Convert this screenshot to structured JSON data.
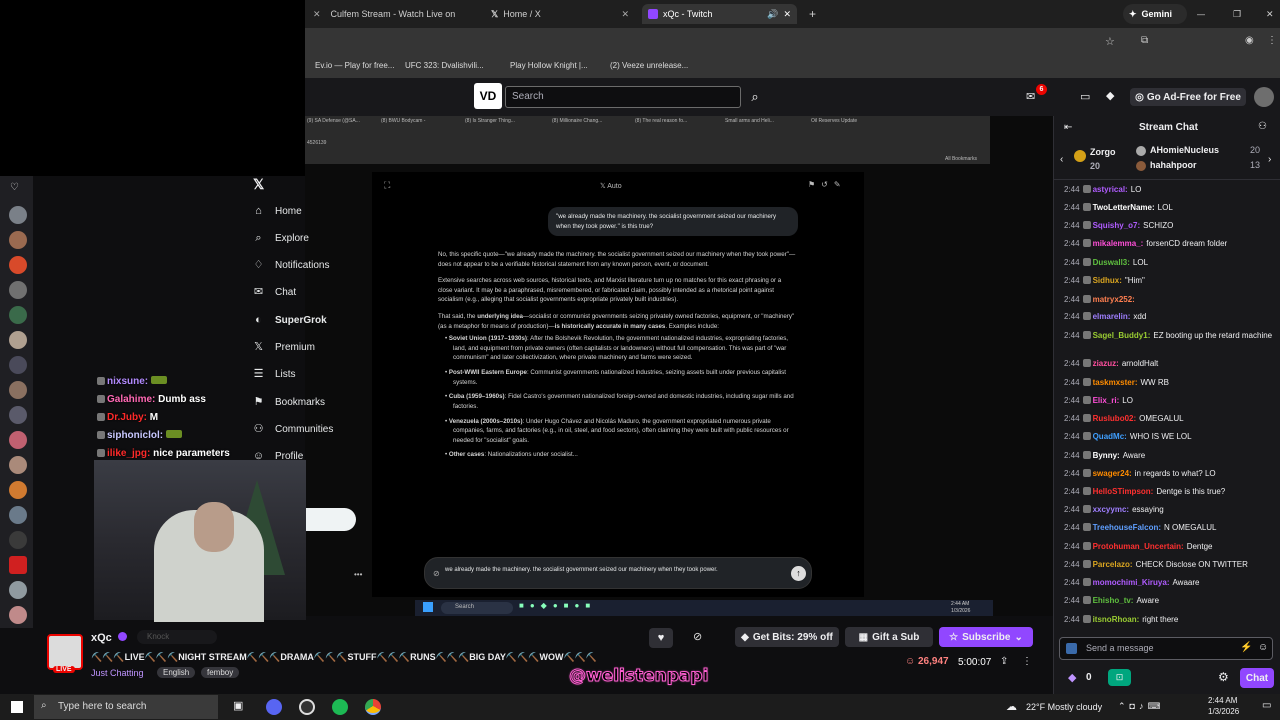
{
  "browser": {
    "tabs": [
      "Culfem Stream - Watch Live on",
      "Home / X",
      "xQc - Twitch"
    ],
    "gemini": "Gemini",
    "bookmarks": [
      "Ev.io — Play for free...",
      "UFC 323: Dvalishvili...",
      "Play Hollow Knight |...",
      "(2) Veeze unrelease..."
    ]
  },
  "twitch_nav": {
    "search_placeholder": "Search",
    "notif_count": "6",
    "ad_free": "Go Ad-Free for Free"
  },
  "inner_browser": {
    "tabs": [
      "(9) SA Defense (@SA...",
      "(8) BWU Bodycam -",
      "(8) Is Stranger Thing...",
      "(8) Millionaire Chang...",
      "(8) The real reason fo...",
      "Small arms and Heli...",
      "Oil Reserves Update"
    ],
    "url": "4526139",
    "all_bookmarks": "All Bookmarks"
  },
  "x_sidebar": [
    "Home",
    "Explore",
    "Notifications",
    "Chat",
    "SuperGrok",
    "Premium",
    "Lists",
    "Bookmarks",
    "Communities",
    "Profile"
  ],
  "grok": {
    "mode": "Auto",
    "user_msg": "\"we already made the machinery. the socialist government seized our machinery when they took power.\" is this true?",
    "p1": "No, this specific quote—\"we already made the machinery. the socialist government seized our machinery when they took power\"—does not appear to be a verifiable historical statement from any known person, event, or document.",
    "p2": "Extensive searches across web sources, historical texts, and Marxist literature turn up no matches for this exact phrasing or a close variant. It may be a paraphrased, misremembered, or fabricated claim, possibly intended as a rhetorical point against socialism (e.g., alleging that socialist governments expropriate privately built industries).",
    "p3a": "That said, the ",
    "p3b": "underlying idea",
    "p3c": "—socialist or communist governments seizing privately owned factories, equipment, or \"machinery\" (as a metaphor for means of production)—",
    "p3d": "is historically accurate in many cases",
    "p3e": ". Examples include:",
    "bullets": [
      {
        "h": "Soviet Union (1917–1930s)",
        "t": ": After the Bolshevik Revolution, the government nationalized industries, expropriating factories, land, and equipment from private owners (often capitalists or landowners) without full compensation. This was part of \"war communism\" and later collectivization, where private machinery and farms were seized."
      },
      {
        "h": "Post-WWII Eastern Europe",
        "t": ": Communist governments nationalized industries, seizing assets built under previous capitalist systems."
      },
      {
        "h": "Cuba (1959–1960s)",
        "t": ": Fidel Castro's government nationalized foreign-owned and domestic industries, including sugar mills and factories."
      },
      {
        "h": "Venezuela (2000s–2010s)",
        "t": ": Under Hugo Chávez and Nicolás Maduro, the government expropriated numerous private companies, farms, and factories (e.g., in oil, steel, and food sectors), often claiming they were built with public resources or needed for \"socialist\" goals."
      },
      {
        "h": "Other cases",
        "t": ": Nationalizations under socialist..."
      }
    ],
    "input_value": "we already made the machinery. the socialist government seized our machinery when they took power."
  },
  "overlay_chat": [
    {
      "user": "nixsune:",
      "msg": "",
      "color": "#9147ff"
    },
    {
      "user": "Galahime:",
      "msg": "Dumb ass",
      "color": "#ff69b4"
    },
    {
      "user": "Dr.Juby:",
      "msg": "M",
      "color": "#ff2a2a"
    },
    {
      "user": "siphoniclol:",
      "msg": "",
      "color": "#c0c0ff"
    },
    {
      "user": "ilike_jpg:",
      "msg": "nice parameters",
      "color": "#ff2a2a"
    }
  ],
  "win_taskbar_inner": {
    "search": "Search",
    "time": "2:44 AM",
    "date": "1/3/2026"
  },
  "stream_info": {
    "channel": "xQc",
    "title": "⛏️⛏️⛏️LIVE⛏️⛏️⛏️NIGHT STREAM⛏️⛏️⛏️DRAMA⛏️⛏️⛏️STUFF⛏️⛏️⛏️RUNS⛏️⛏️⛏️BIG DAY⛏️⛏️⛏️WOW⛏️⛏️⛏️",
    "category": "Just Chatting",
    "tags": [
      "English",
      "femboy"
    ],
    "live": "LIVE",
    "viewers": "26,947",
    "uptime": "5:00:07",
    "get_bits": "Get Bits: 29% off",
    "gift_sub": "Gift a Sub",
    "subscribe": "Subscribe",
    "knock": "Knock",
    "watermark": "@welistenpapi"
  },
  "chat": {
    "title": "Stream Chat",
    "gifters": [
      {
        "name": "Zorgo",
        "count": "20"
      },
      {
        "name": "AHomieNucleus",
        "count": "20"
      },
      {
        "name": "hahahpoor",
        "count": "13"
      }
    ],
    "messages": [
      {
        "t": "2:44",
        "u": "astyrical:",
        "m": "LO",
        "c": "#b05cff"
      },
      {
        "t": "2:44",
        "u": "TwoLetterName:",
        "m": "LOL",
        "c": "#ffffff"
      },
      {
        "t": "2:44",
        "u": "Squishy_o7:",
        "m": "SCHIZO",
        "c": "#b05cff"
      },
      {
        "t": "2:44",
        "u": "mikalemma_:",
        "m": "forsenCD dream folder",
        "c": "#ff4fd8"
      },
      {
        "t": "2:44",
        "u": "Duswall3:",
        "m": "LOL",
        "c": "#5fbf3f"
      },
      {
        "t": "2:44",
        "u": "Sidhux:",
        "m": "\"Him\"",
        "c": "#daa520"
      },
      {
        "t": "2:44",
        "u": "matryx252:",
        "m": "",
        "c": "#ff7f50"
      },
      {
        "t": "2:44",
        "u": "elmarelin:",
        "m": "xdd",
        "c": "#9f7fff"
      },
      {
        "t": "2:44",
        "u": "Sagel_Buddy1:",
        "m": "EZ booting up the retard machine",
        "c": "#9acd32"
      },
      {
        "t": "2:44",
        "u": "ziazuz:",
        "m": "arnoldHalt",
        "c": "#ff4f9f"
      },
      {
        "t": "2:44",
        "u": "taskmxster:",
        "m": "WW RB",
        "c": "#ff8c00"
      },
      {
        "t": "2:44",
        "u": "Elix_ri:",
        "m": "LO",
        "c": "#ff4fd8"
      },
      {
        "t": "2:44",
        "u": "Ruslubo02:",
        "m": "OMEGALUL",
        "c": "#ff3030"
      },
      {
        "t": "2:44",
        "u": "QuadMc:",
        "m": "WHO IS WE LOL",
        "c": "#3f9fff"
      },
      {
        "t": "2:44",
        "u": "Bynny:",
        "m": "Aware",
        "c": "#ffffff"
      },
      {
        "t": "2:44",
        "u": "swager24:",
        "m": "in regards to what? LO",
        "c": "#ff8c00"
      },
      {
        "t": "2:44",
        "u": "HelloSTimpson:",
        "m": "Dentge is this true?",
        "c": "#ff3030"
      },
      {
        "t": "2:44",
        "u": "xxcyymc:",
        "m": "essaying",
        "c": "#9f7fff"
      },
      {
        "t": "2:44",
        "u": "TreehouseFalcon:",
        "m": "N OMEGALUL",
        "c": "#5f9fff"
      },
      {
        "t": "2:44",
        "u": "Protohuman_Uncertain:",
        "m": "Dentge",
        "c": "#ff3030"
      },
      {
        "t": "2:44",
        "u": "Parcelazo:",
        "m": "CHECK Disclose ON TWITTER",
        "c": "#daa520"
      },
      {
        "t": "2:44",
        "u": "momochimi_Kiruya:",
        "m": "Awaare",
        "c": "#b05cff"
      },
      {
        "t": "2:44",
        "u": "Ehisho_tv:",
        "m": "Aware",
        "c": "#5fbf3f"
      },
      {
        "t": "2:44",
        "u": "itsnoRhoan:",
        "m": "right there",
        "c": "#9acd32"
      }
    ],
    "placeholder": "Send a message",
    "points": "0",
    "chat_btn": "Chat"
  },
  "taskbar": {
    "search": "Type here to search",
    "weather": "22°F  Mostly cloudy",
    "time": "2:44 AM",
    "date": "1/3/2026"
  }
}
